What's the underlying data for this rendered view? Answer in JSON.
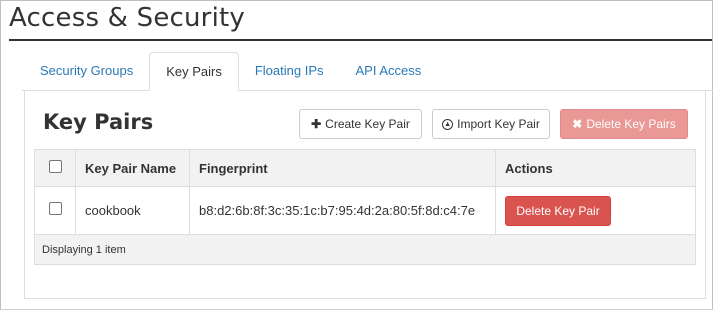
{
  "header": {
    "title": "Access & Security"
  },
  "tabs": [
    {
      "label": "Security Groups",
      "active": false
    },
    {
      "label": "Key Pairs",
      "active": true
    },
    {
      "label": "Floating IPs",
      "active": false
    },
    {
      "label": "API Access",
      "active": false
    }
  ],
  "section": {
    "title": "Key Pairs",
    "create_label": "Create Key Pair",
    "import_label": "Import Key Pair",
    "delete_label": "Delete Key Pairs"
  },
  "table": {
    "headers": {
      "name": "Key Pair Name",
      "fingerprint": "Fingerprint",
      "actions": "Actions"
    },
    "rows": [
      {
        "name": "cookbook",
        "fingerprint": "b8:d2:6b:8f:3c:35:1c:b7:95:4d:2a:80:5f:8d:c4:7e",
        "action_label": "Delete Key Pair"
      }
    ],
    "footer": "Displaying 1 item"
  },
  "icons": {
    "create": "plus-icon",
    "import": "upload-circle-icon",
    "delete": "times-icon"
  },
  "colors": {
    "link": "#2a7ab8",
    "danger": "#d9534f",
    "danger_disabled": "#e99896"
  }
}
